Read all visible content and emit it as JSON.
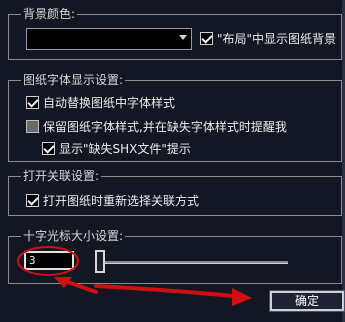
{
  "background_group": {
    "title": "背景颜色:",
    "color_value": "",
    "layout_checkbox_label": "\"布局\"中显示图纸背景",
    "layout_checked": true
  },
  "font_group": {
    "title": "图纸字体显示设置:",
    "auto_replace_label": "自动替换图纸中字体样式",
    "auto_replace_checked": true,
    "keep_style_label": "保留图纸字体样式,并在缺失字体样式时提醒我",
    "keep_style_checked": false,
    "show_shx_label": "显示\"缺失SHX文件\"提示",
    "show_shx_checked": true
  },
  "open_assoc_group": {
    "title": "打开关联设置:",
    "reselect_label": "打开图纸时重新选择关联方式",
    "reselect_checked": true
  },
  "crosshair_group": {
    "title": "十字光标大小设置:",
    "size_value": "3"
  },
  "ok_button": "确定",
  "colors": {
    "annotation_arrow": "#d01010",
    "panel_bg": "#121723"
  }
}
